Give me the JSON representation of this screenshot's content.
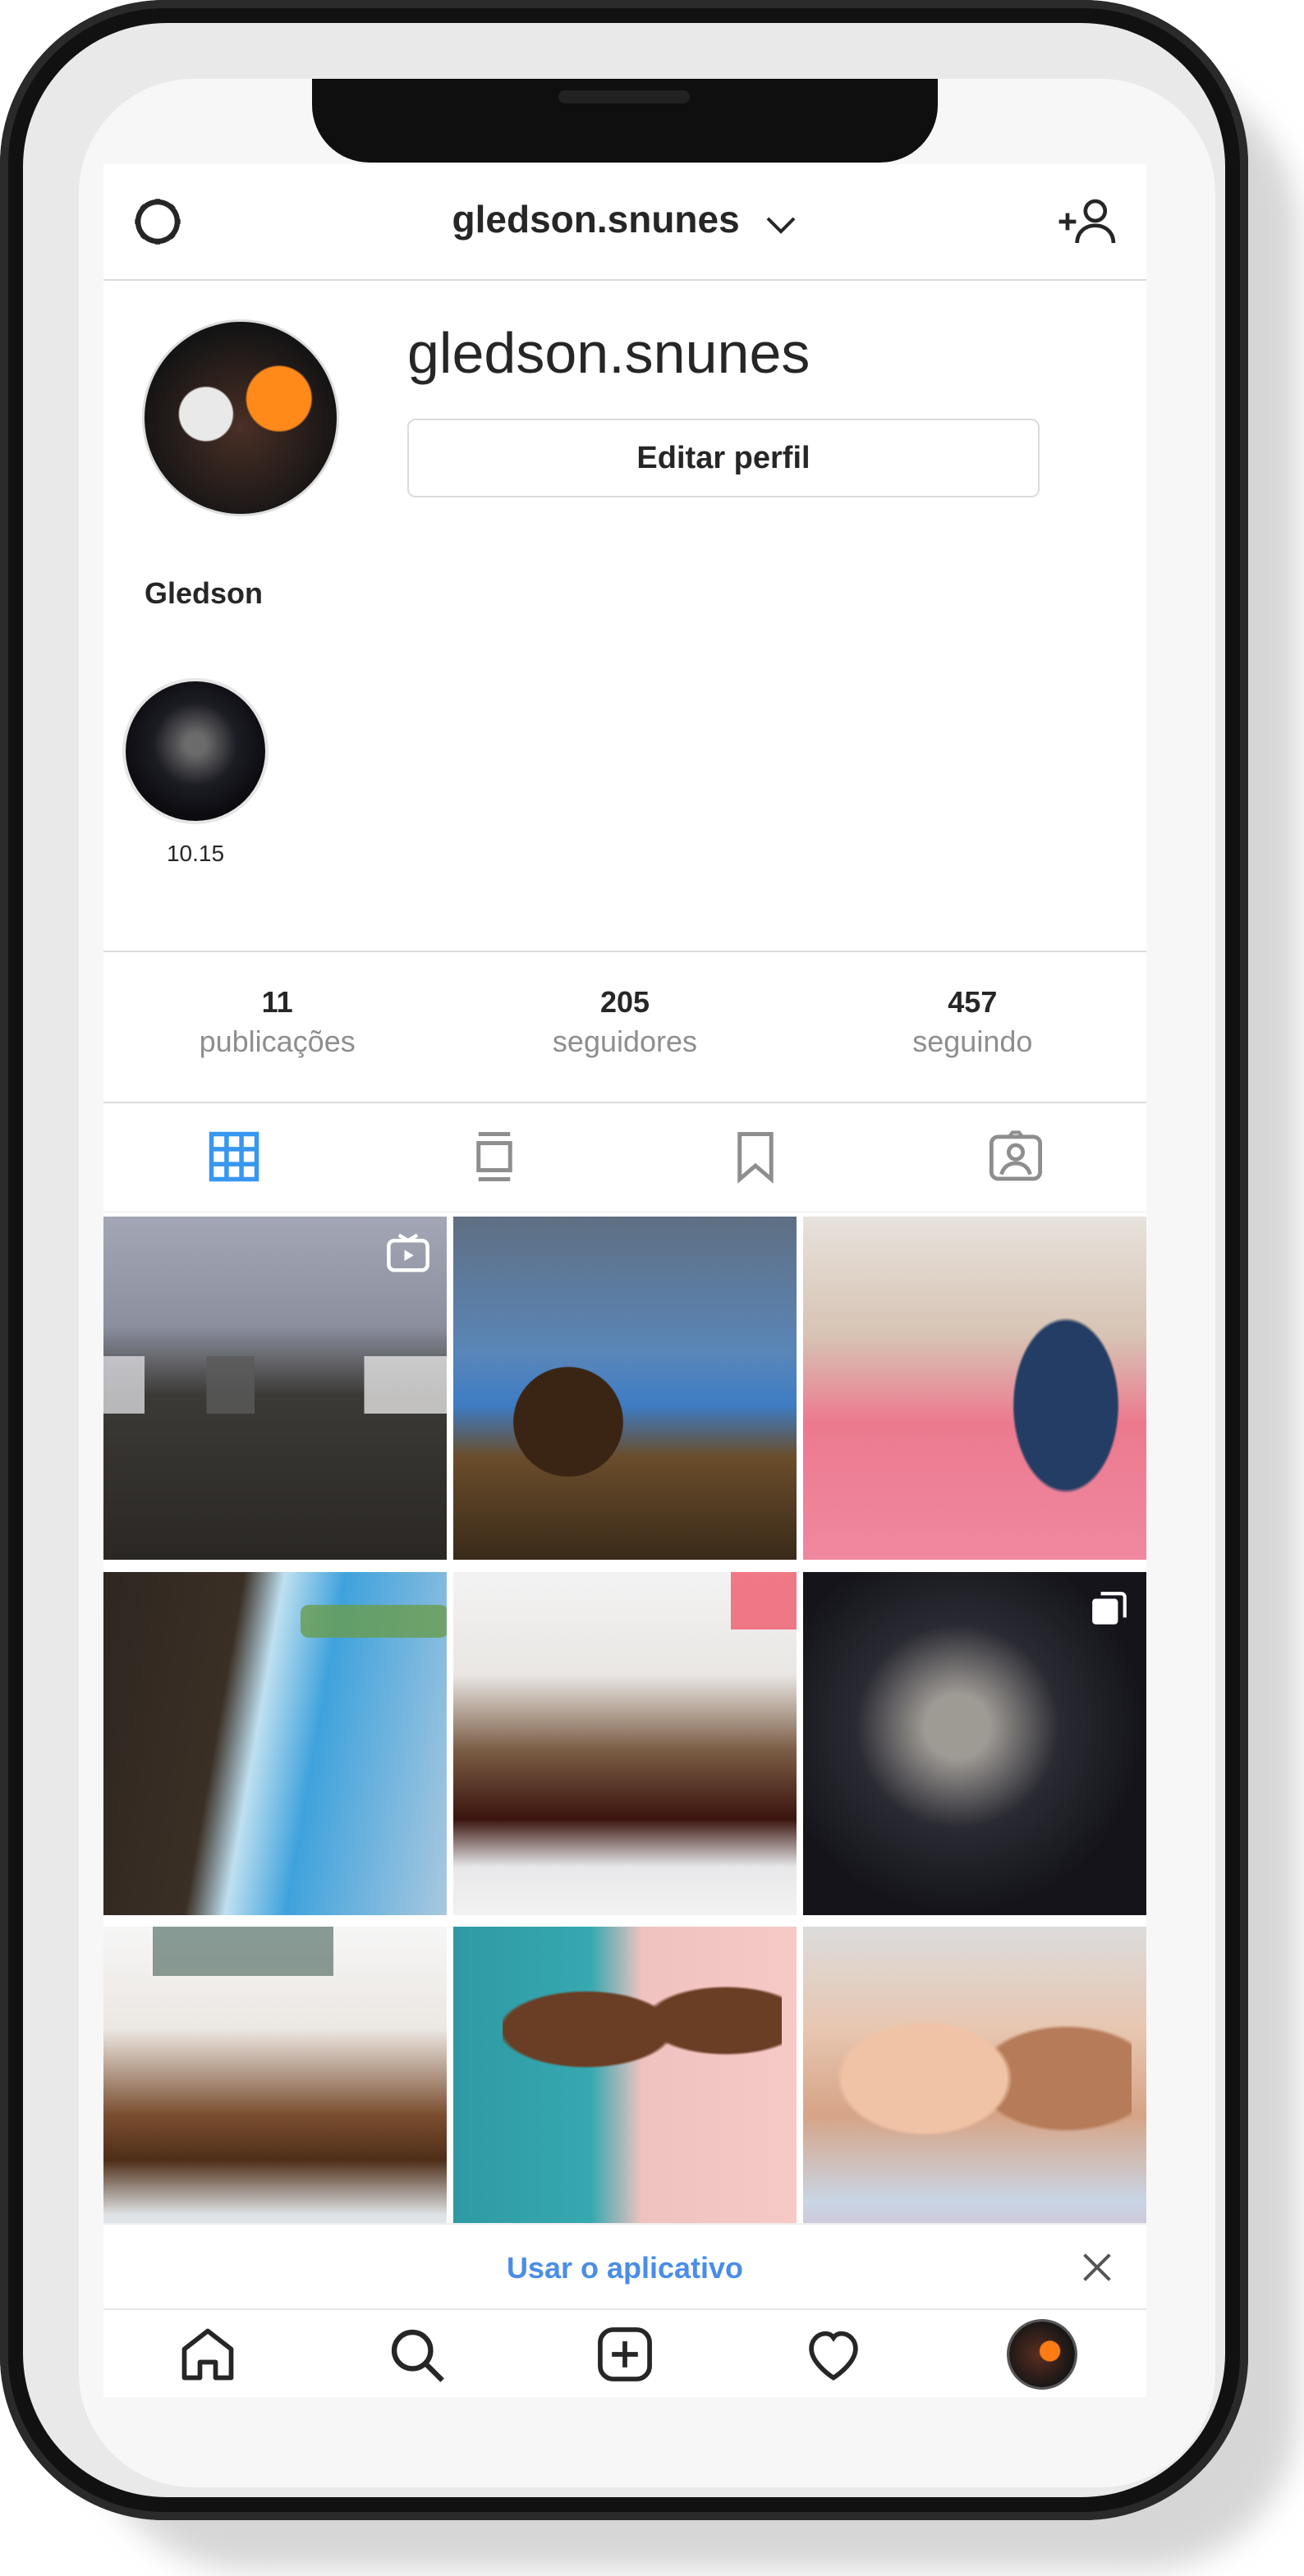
{
  "header": {
    "username": "gledson.snunes"
  },
  "profile": {
    "username": "gledson.snunes",
    "edit_button": "Editar perfil",
    "full_name": "Gledson",
    "highlights": [
      {
        "label": "10.15"
      }
    ]
  },
  "stats": [
    {
      "value": "11",
      "label": "publicações"
    },
    {
      "value": "205",
      "label": "seguidores"
    },
    {
      "value": "457",
      "label": "seguindo"
    }
  ],
  "tabs": [
    {
      "name": "grid",
      "icon": "grid-icon",
      "active": true
    },
    {
      "name": "feed",
      "icon": "feed-icon",
      "active": false
    },
    {
      "name": "saved",
      "icon": "bookmark-icon",
      "active": false
    },
    {
      "name": "tagged",
      "icon": "tagged-icon",
      "active": false
    }
  ],
  "posts": [
    {
      "kind": "street-evening",
      "badge": "igtv-icon"
    },
    {
      "kind": "bus-selfie",
      "badge": null
    },
    {
      "kind": "family-sofa",
      "badge": null
    },
    {
      "kind": "pool-child",
      "badge": null
    },
    {
      "kind": "dessert-cup",
      "badge": null
    },
    {
      "kind": "skull-art",
      "badge": "carousel-icon"
    },
    {
      "kind": "coffee-cup",
      "badge": null
    },
    {
      "kind": "kids-cake",
      "badge": null
    },
    {
      "kind": "kids-selfie",
      "badge": null
    }
  ],
  "banner": {
    "link": "Usar o aplicativo"
  },
  "colors": {
    "accent": "#3897f0",
    "banner_link": "#4a8de8",
    "text": "#262626",
    "muted": "#8e8e8e",
    "border": "#dbdbdb"
  }
}
